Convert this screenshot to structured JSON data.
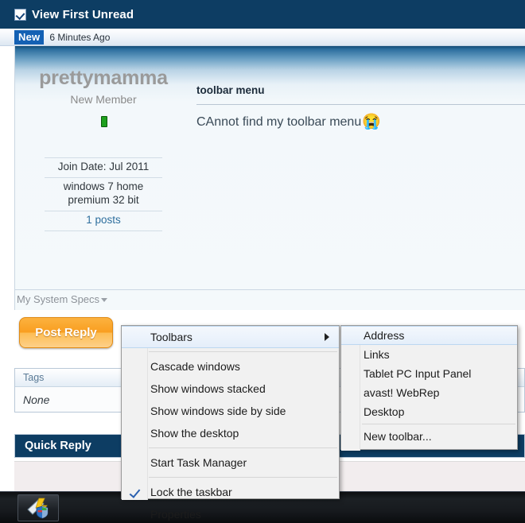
{
  "topbar": {
    "title": "View First Unread",
    "checkbox_icon": "checkbox-checked-icon"
  },
  "newstrip": {
    "badge": "New",
    "time": "6 Minutes Ago"
  },
  "post": {
    "username": "prettymamma",
    "usertitle": "New Member",
    "status": "online",
    "stats": [
      {
        "label": "Join Date: Jul 2011",
        "link": false
      },
      {
        "label": "windows 7 home premium 32 bit",
        "link": false
      },
      {
        "label": "1 posts",
        "link": true
      }
    ],
    "title": "toolbar menu",
    "body": "CAnnot find my toolbar menu",
    "emoji": "😭",
    "specs_link": "My System Specs"
  },
  "actions": {
    "post_reply": "Post Reply"
  },
  "tags": {
    "header": "Tags",
    "value": "None"
  },
  "quick_reply": {
    "title": "Quick Reply"
  },
  "context_menu": {
    "items": [
      {
        "label": "Toolbars",
        "highlighted": true,
        "submenu": true
      },
      {
        "separator": true
      },
      {
        "label": "Cascade windows"
      },
      {
        "label": "Show windows stacked"
      },
      {
        "label": "Show windows side by side"
      },
      {
        "label": "Show the desktop"
      },
      {
        "separator": true
      },
      {
        "label": "Start Task Manager"
      },
      {
        "separator": true
      },
      {
        "label": "Lock the taskbar",
        "checked": true
      },
      {
        "label": "Properties"
      }
    ]
  },
  "submenu": {
    "items": [
      {
        "label": "Address",
        "highlighted": true
      },
      {
        "label": "Links"
      },
      {
        "label": "Tablet PC Input Panel"
      },
      {
        "label": "avast! WebRep"
      },
      {
        "label": "Desktop"
      },
      {
        "separator": true
      },
      {
        "label": "New toolbar..."
      }
    ]
  },
  "taskbar": {
    "button_icon": "avast-shield-icon"
  },
  "colors": {
    "header_blue": "#0d3d63",
    "badge_blue": "#1461b4",
    "accent_orange": "#f99e20",
    "status_green": "#1ea01e",
    "link_blue": "#2f6f9e"
  }
}
